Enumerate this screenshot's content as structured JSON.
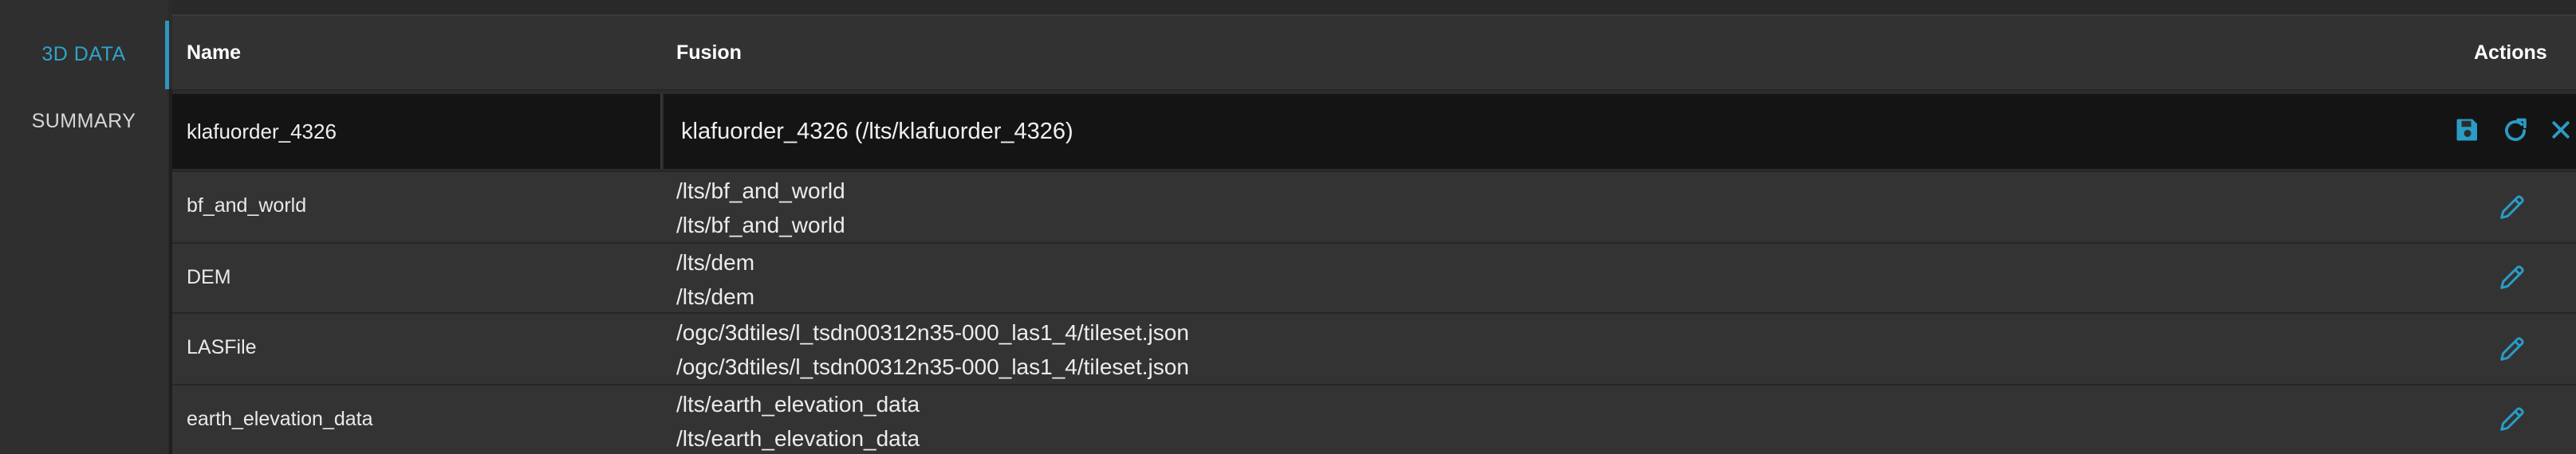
{
  "sidebar": {
    "items": [
      {
        "label": "3D DATA",
        "active": true
      },
      {
        "label": "SUMMARY",
        "active": false
      }
    ]
  },
  "table": {
    "columns": {
      "name": "Name",
      "fusion": "Fusion",
      "actions": "Actions"
    },
    "edit_row": {
      "name": "klafuorder_4326",
      "selected_fusion": "klafuorder_4326 (/lts/klafuorder_4326)",
      "actions": [
        "save-icon",
        "refresh-icon",
        "close-icon"
      ]
    },
    "rows": [
      {
        "name": "bf_and_world",
        "fusion": [
          "/lts/bf_and_world",
          "/lts/bf_and_world"
        ],
        "action": "pencil-icon"
      },
      {
        "name": "DEM",
        "fusion": [
          "/lts/dem",
          "/lts/dem"
        ],
        "action": "pencil-icon"
      },
      {
        "name": "LASFile",
        "fusion": [
          "/ogc/3dtiles/l_tsdn00312n35-000_las1_4/tileset.json",
          "/ogc/3dtiles/l_tsdn00312n35-000_las1_4/tileset.json"
        ],
        "action": "pencil-icon"
      },
      {
        "name": "earth_elevation_data",
        "fusion": [
          "/lts/earth_elevation_data",
          "/lts/earth_elevation_data"
        ],
        "action": "pencil-icon"
      }
    ]
  },
  "colors": {
    "accent": "#2fa3c7",
    "background": "#333333",
    "sidebar": "#2f2f2f",
    "input_bg": "#141414"
  }
}
